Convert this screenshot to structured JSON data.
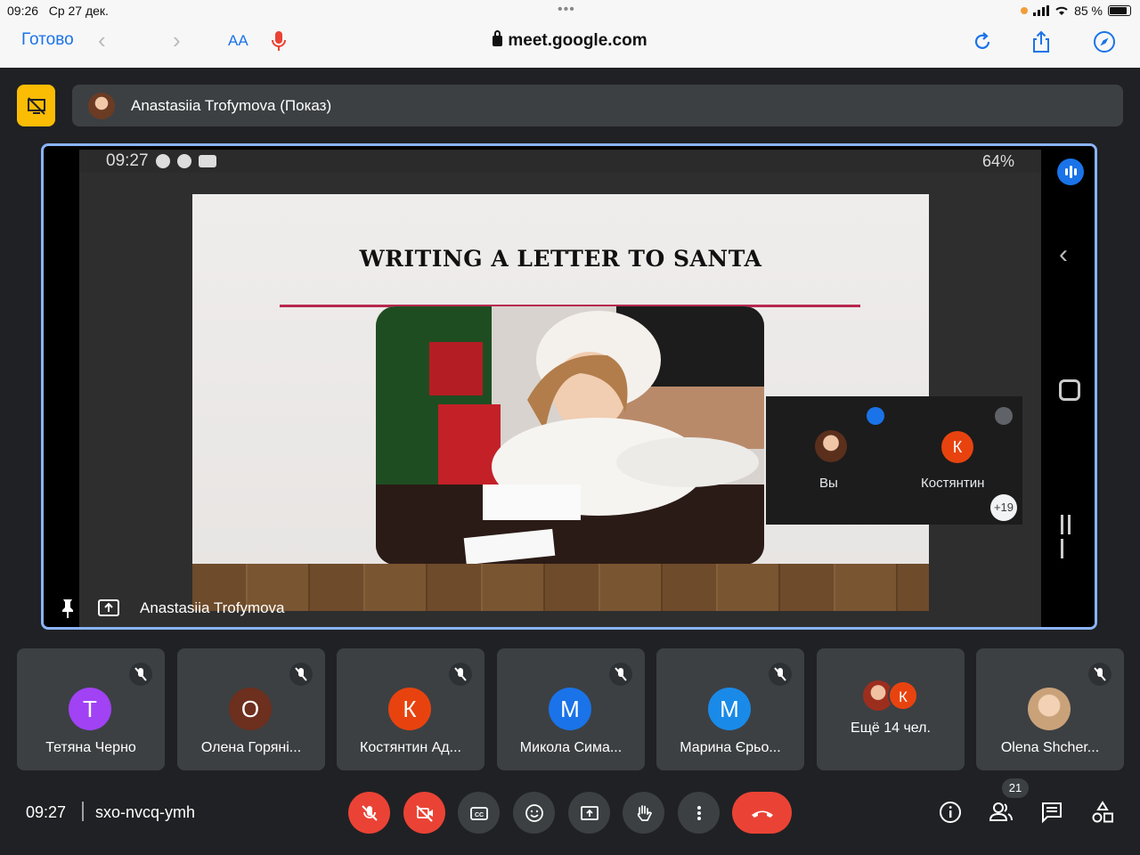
{
  "ios_status": {
    "time": "09:26",
    "date": "Ср 27 дек.",
    "battery": "85 %"
  },
  "safari": {
    "done_label": "Готово",
    "aa_label": "АА",
    "url": "meet.google.com"
  },
  "presentation": {
    "presenter_label": "Anastasiia Trofymova (Показ)"
  },
  "phone": {
    "time": "09:27",
    "battery": "64%"
  },
  "slide": {
    "title": "WRITING A LETTER TO SANTA"
  },
  "pip": {
    "self_label": "Вы",
    "other_initial": "К",
    "other_name": "Костянтин",
    "more": "+19"
  },
  "stage": {
    "presenter_name": "Anastasiia Trofymova"
  },
  "participants": [
    {
      "initial": "Т",
      "name": "Тетяна Черно",
      "color": "#a142f4"
    },
    {
      "initial": "О",
      "name": "Олена Горяні...",
      "color": "#6d2f1e"
    },
    {
      "initial": "К",
      "name": "Костянтин Ад...",
      "color": "#e8430f"
    },
    {
      "initial": "М",
      "name": "Микола Сима...",
      "color": "#1a73e8"
    },
    {
      "initial": "М",
      "name": "Марина Єрьо...",
      "color": "#1a8ae8"
    },
    {
      "initial": "К",
      "name": "Ещё 14 чел.",
      "color": "#e8430f"
    },
    {
      "initial": "",
      "name": "Olena Shcher...",
      "color": "#c9a27a"
    }
  ],
  "bottom": {
    "time": "09:27",
    "meeting_code": "sxo-nvcq-ymh",
    "participant_count": "21"
  },
  "icons": {
    "mic_off": "mic-off-icon",
    "cam_off": "videocam-off-icon",
    "cc": "closed-caption-icon",
    "emoji": "emoji-icon",
    "present": "present-icon",
    "hand": "raise-hand-icon",
    "more": "more-vert-icon",
    "end": "call-end-icon",
    "info": "info-icon",
    "people": "people-icon",
    "chat": "chat-icon",
    "activities": "activities-icon"
  },
  "colors": {
    "accent": "#8ab4f8",
    "danger": "#ea4335",
    "present_yellow": "#fbbc04"
  }
}
